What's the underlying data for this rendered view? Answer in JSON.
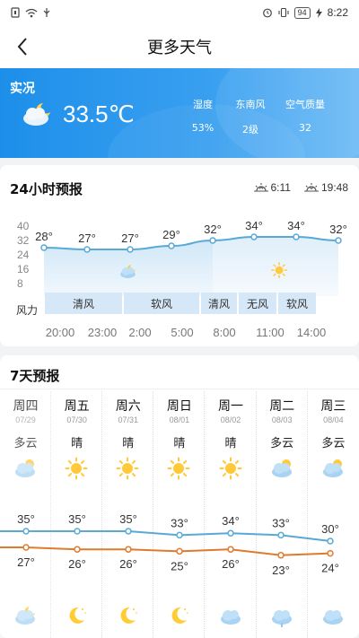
{
  "status": {
    "time": "8:22",
    "battery": "94"
  },
  "nav": {
    "title": "更多天气"
  },
  "realtime": {
    "label": "实况",
    "temperature": "33.5℃",
    "stats": [
      {
        "label": "湿度",
        "value": "53%"
      },
      {
        "label": "东南风",
        "value": "2级"
      },
      {
        "label": "空气质量",
        "value": "32"
      }
    ]
  },
  "hourly": {
    "title": "24小时预报",
    "sunrise": "6:11",
    "sunset": "19:48",
    "y_ticks": [
      "40",
      "32",
      "24",
      "16",
      "8"
    ],
    "temps": [
      28,
      27,
      27,
      29,
      32,
      34,
      34,
      32
    ],
    "temp_labels": [
      "28°",
      "27°",
      "27°",
      "29°",
      "32°",
      "34°",
      "34°",
      "32°"
    ],
    "wind_label": "风力",
    "wind": [
      "清风",
      "软风",
      "清风",
      "无风",
      "软风"
    ],
    "times": [
      "20:00",
      "23:00",
      "2:00",
      "5:00",
      "8:00",
      "11:00",
      "14:00"
    ]
  },
  "daily": {
    "title": "7天预报",
    "days": [
      {
        "name": "周四",
        "date": "07/29",
        "cond": "多云",
        "icon": "partly-cloudy-day-icon",
        "high": 35,
        "low": 27,
        "night_icon": "partly-cloudy-night-icon"
      },
      {
        "name": "周五",
        "date": "07/30",
        "cond": "晴",
        "icon": "sun-icon",
        "high": 35,
        "low": 26,
        "night_icon": "moon-icon"
      },
      {
        "name": "周六",
        "date": "07/31",
        "cond": "晴",
        "icon": "sun-icon",
        "high": 35,
        "low": 26,
        "night_icon": "moon-icon"
      },
      {
        "name": "周日",
        "date": "08/01",
        "cond": "晴",
        "icon": "sun-icon",
        "high": 33,
        "low": 25,
        "night_icon": "moon-icon"
      },
      {
        "name": "周一",
        "date": "08/02",
        "cond": "晴",
        "icon": "sun-icon",
        "high": 34,
        "low": 26,
        "night_icon": "cloud-icon"
      },
      {
        "name": "周二",
        "date": "08/03",
        "cond": "多云",
        "icon": "partly-cloudy-day-icon",
        "high": 33,
        "low": 23,
        "night_icon": "rain-icon"
      },
      {
        "name": "周三",
        "date": "08/04",
        "cond": "多云",
        "icon": "partly-cloudy-day-icon",
        "high": 30,
        "low": 24,
        "night_icon": "cloud-icon"
      }
    ],
    "high_labels": [
      "35°",
      "35°",
      "35°",
      "33°",
      "34°",
      "33°",
      "30°"
    ],
    "low_labels": [
      "27°",
      "26°",
      "26°",
      "25°",
      "26°",
      "23°",
      "24°"
    ]
  },
  "colors": {
    "high_line": "#58a9d6",
    "low_line": "#e07a2c",
    "accent": "#2a93ea"
  }
}
